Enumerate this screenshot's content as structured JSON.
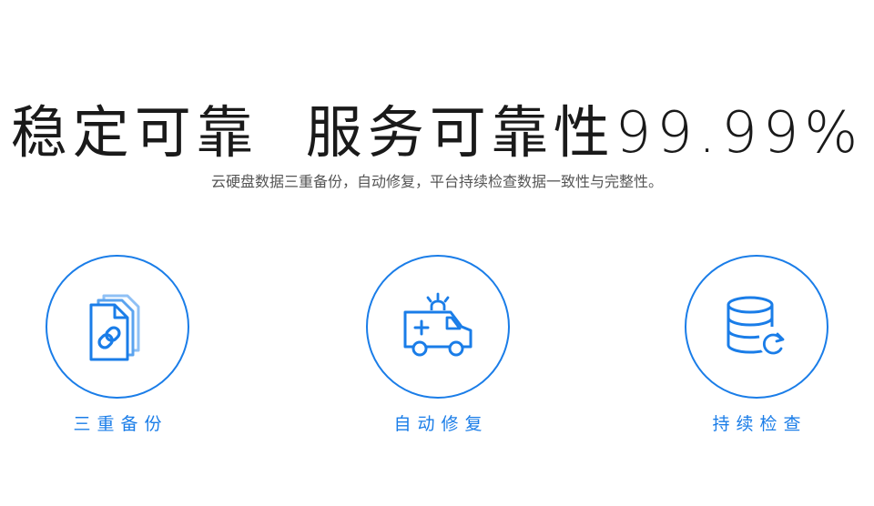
{
  "headline": {
    "part1": "稳定可靠",
    "part2": "服务可靠性99.99%"
  },
  "subtitle": "云硬盘数据三重备份，自动修复，平台持续检查数据一致性与完整性。",
  "features": [
    {
      "label": "三重备份",
      "icon": "linked-documents-icon"
    },
    {
      "label": "自动修复",
      "icon": "ambulance-icon"
    },
    {
      "label": "持续检查",
      "icon": "database-refresh-icon"
    }
  ],
  "colors": {
    "accent": "#1a7de8",
    "accent_light": "#8fc0f5",
    "headline": "#1a1a1a",
    "subtitle": "#555555",
    "background": "#ffffff"
  }
}
